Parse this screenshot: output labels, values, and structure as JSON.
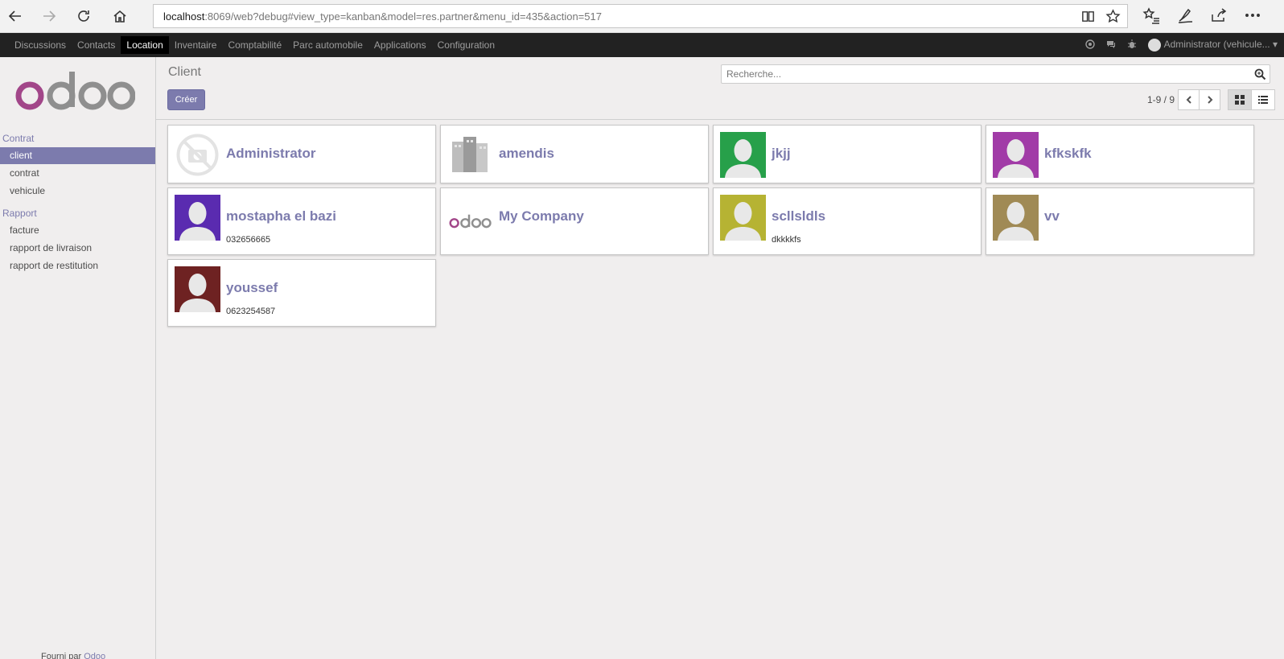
{
  "browser": {
    "url_host": "localhost",
    "url_rest": ":8069/web?debug#view_type=kanban&model=res.partner&menu_id=435&action=517"
  },
  "topmenu": {
    "items": [
      "Discussions",
      "Contacts",
      "Location",
      "Inventaire",
      "Comptabilité",
      "Parc automobile",
      "Applications",
      "Configuration"
    ],
    "active": "Location",
    "user": "Administrator (vehicule..."
  },
  "sidebar": {
    "sections": [
      {
        "title": "Contrat",
        "items": [
          "client",
          "contrat",
          "vehicule"
        ]
      },
      {
        "title": "Rapport",
        "items": [
          "facture",
          "rapport de livraison",
          "rapport de restitution"
        ]
      }
    ],
    "active_item": "client",
    "powered_prefix": "Fourni par",
    "powered_brand": "Odoo"
  },
  "control": {
    "title": "Client",
    "create_label": "Créer",
    "search_placeholder": "Recherche...",
    "pager": "1-9 / 9"
  },
  "cards": [
    {
      "name": "Administrator",
      "sub": "",
      "avatar": "placeholder",
      "color": "#ffffff"
    },
    {
      "name": "amendis",
      "sub": "",
      "avatar": "company",
      "color": "#ffffff"
    },
    {
      "name": "jkjj",
      "sub": "",
      "avatar": "person",
      "color": "#27a04a"
    },
    {
      "name": "kfkskfk",
      "sub": "",
      "avatar": "person",
      "color": "#a13ba7"
    },
    {
      "name": "mostapha el bazi",
      "sub": "032656665",
      "avatar": "person",
      "color": "#5a2bb0"
    },
    {
      "name": "My Company",
      "sub": "",
      "avatar": "odoo-logo",
      "color": "#ffffff"
    },
    {
      "name": "scllsldls",
      "sub": "dkkkkfs",
      "avatar": "person",
      "color": "#b6b333"
    },
    {
      "name": "vv",
      "sub": "",
      "avatar": "person",
      "color": "#a08a55"
    },
    {
      "name": "youssef",
      "sub": "0623254587",
      "avatar": "person",
      "color": "#6e2222"
    }
  ],
  "colors": {
    "accent": "#7c7bad",
    "topbar": "#222222",
    "background": "#f0eeee"
  }
}
